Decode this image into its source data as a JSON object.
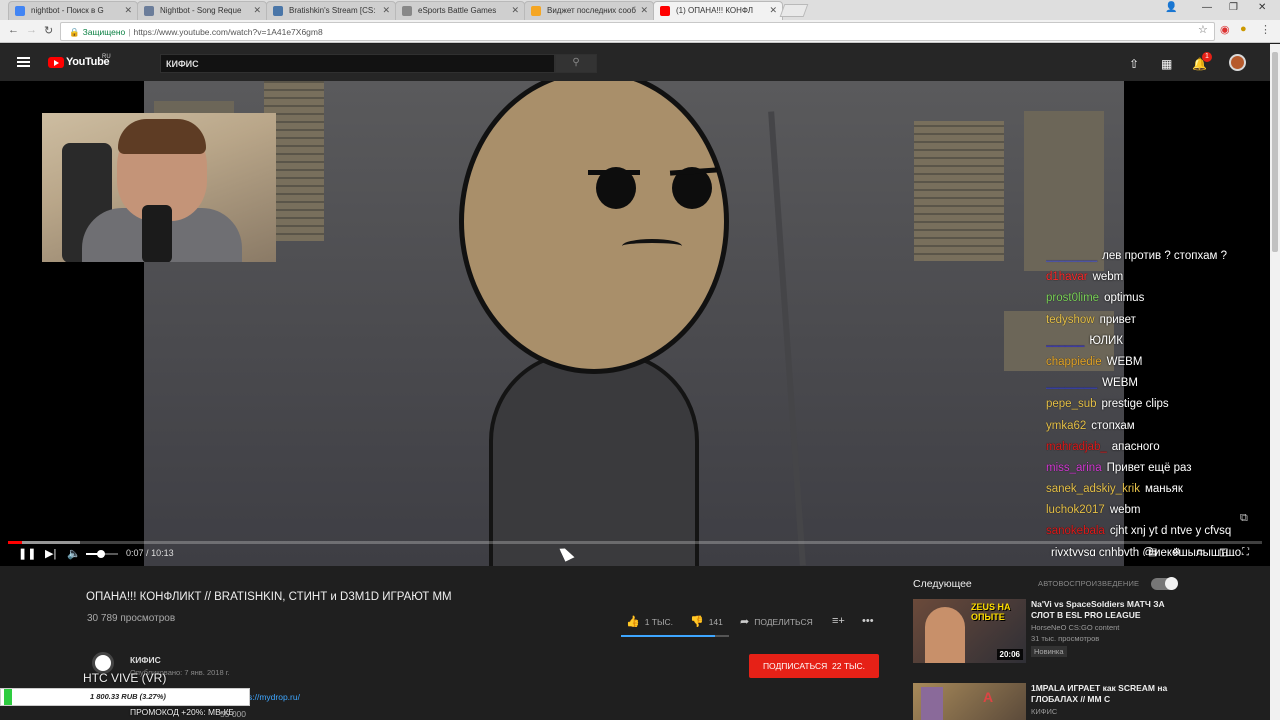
{
  "browser": {
    "tabs": [
      {
        "label": "nightbot - Поиск в G",
        "favicon_color": "#4285f4",
        "active": false
      },
      {
        "label": "Nightbot - Song Reque",
        "favicon_color": "#6b7d9a",
        "active": false
      },
      {
        "label": "Bratishkin's Stream [CS:",
        "favicon_color": "#4a76a8",
        "active": false
      },
      {
        "label": "eSports Battle Games",
        "favicon_color": "#888888",
        "active": false
      },
      {
        "label": "Виджет последних сооб",
        "favicon_color": "#f5a623",
        "active": false
      },
      {
        "label": "(1) ОПАНА!!! КОНФЛ",
        "favicon_color": "#ff0000",
        "active": true
      }
    ],
    "secure_label": "Защищено",
    "url": "https://www.youtube.com/watch?v=1A41e7X6gm8"
  },
  "youtube": {
    "logo_text": "YouTube",
    "logo_region": "RU",
    "search_value": "КИФИС",
    "notification_count": "1"
  },
  "player": {
    "time_current": "0:07",
    "time_separator": "/",
    "time_total": "10:13",
    "progress_fraction": 0.011
  },
  "chat": {
    "messages": [
      {
        "user": "________",
        "color": "#4a5cff",
        "text": "лев против ? стопхам ?"
      },
      {
        "user": "d1havar",
        "color": "#ff2a2a",
        "text": "webm"
      },
      {
        "user": "prost0lime",
        "color": "#7cd35a",
        "text": "optimus"
      },
      {
        "user": "tedyshow",
        "color": "#e7c24a",
        "text": "привет"
      },
      {
        "user": "______",
        "color": "#2a2aff",
        "text": "ЮЛИК"
      },
      {
        "user": "chappiedie",
        "color": "#e7a82a",
        "text": "WEBM"
      },
      {
        "user": "________",
        "color": "#3a4aff",
        "text": "WEBM"
      },
      {
        "user": "pepe_sub",
        "color": "#e7c24a",
        "text": "prestige clips"
      },
      {
        "user": "ymka62",
        "color": "#e7c24a",
        "text": "стопхам"
      },
      {
        "user": "mahradjab_",
        "color": "#e01b1b",
        "text": "апасного"
      },
      {
        "user": "miss_arina",
        "color": "#d33ad3",
        "text": "Привет ещё раз"
      },
      {
        "user": "sanek_adskiy_krik",
        "color": "#e7c24a",
        "text": "маньяк"
      },
      {
        "user": "luchok2017",
        "color": "#e7c24a",
        "text": "webm"
      },
      {
        "user": "sanokebala",
        "color": "#e01b1b",
        "text": "cjht xnj yt d ntve y cfvsq"
      },
      {
        "user": "",
        "color": "#ffffff",
        "text": "rjyxtyysq cnhbvth @иекешылыштщо"
      }
    ]
  },
  "video": {
    "title": "ОПАНА!!! КОНФЛИКТ // BRATISHKIN, СТИНТ и D3M1D ИГРАЮТ ММ",
    "views": "30 789 просмотров",
    "likes": "1 ТЫС.",
    "dislikes": "141",
    "share_label": "ПОДЕЛИТЬСЯ",
    "like_fraction": 0.87,
    "channel_name": "КИФИС",
    "published": "Опубликовано: 7 янв. 2018 г.",
    "subscribe_label": "ПОДПИСАТЬСЯ",
    "subscriber_count": "22 ТЫС.",
    "description_link": "s://mydrop.ru/"
  },
  "overlay": {
    "htc_label": "HTC VIVE (VR)",
    "donation_text": "1 800.33 RUB (3.27%)",
    "donation_fraction": 0.0327,
    "promo_text": "ПРОМОКОД +20%: МВ-КБ",
    "promo_value": "55 000"
  },
  "sidebar": {
    "next_label": "Следующее",
    "autoplay_label": "АВТОВОСПРОИЗВЕДЕНИЕ",
    "recommendations": [
      {
        "title": "Na'Vi vs SpaceSoldiers МАТЧ ЗА СЛОТ В ESL PRO LEAGUE",
        "channel": "HorseNeO CS:GO content",
        "views": "31 тыс. просмотров",
        "badge": "Новинка",
        "duration": "20:06",
        "thumb_text": "ZEUS НА ОПЫТЕ"
      },
      {
        "title": "1MPALA ИГРАЕТ как SCREAM на ГЛОБАЛАХ // MM С",
        "channel": "КИФИС",
        "views": "",
        "badge": "",
        "duration": "",
        "thumb_text": ""
      }
    ]
  }
}
